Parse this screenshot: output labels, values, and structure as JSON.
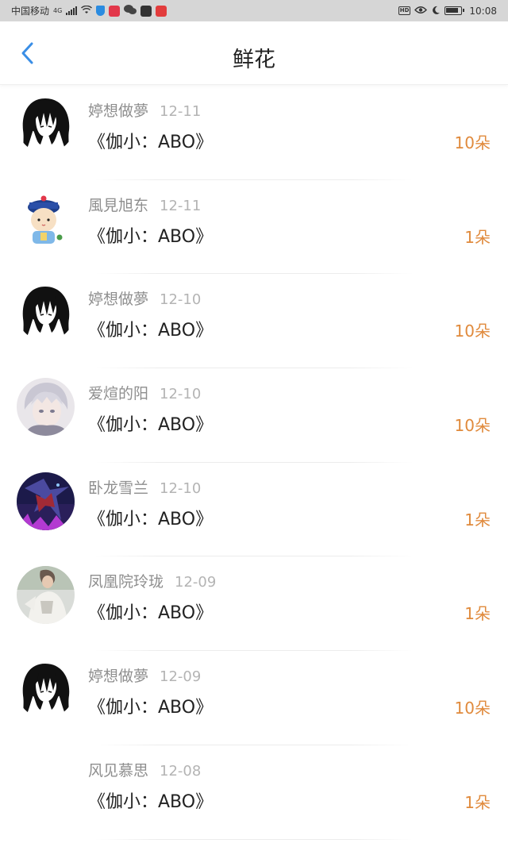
{
  "status_bar": {
    "carrier": "中国移动",
    "network": "4G",
    "time": "10:08",
    "hd_label": "HD"
  },
  "header": {
    "title": "鲜花",
    "back_icon": "chevron-left-icon"
  },
  "items": [
    {
      "name": "婷想做夢",
      "date": "12-11",
      "book": "《伽小：ABO》",
      "count": "10朵",
      "avatar": "black-hair-anime-avatar"
    },
    {
      "name": "風見旭东",
      "date": "12-11",
      "book": "《伽小：ABO》",
      "count": "1朵",
      "avatar": "chibi-qing-official-avatar"
    },
    {
      "name": "婷想做夢",
      "date": "12-10",
      "book": "《伽小：ABO》",
      "count": "10朵",
      "avatar": "black-hair-anime-avatar"
    },
    {
      "name": "爱煊的阳",
      "date": "12-10",
      "book": "《伽小：ABO》",
      "count": "10朵",
      "avatar": "silver-hair-anime-avatar"
    },
    {
      "name": "卧龙雪兰",
      "date": "12-10",
      "book": "《伽小：ABO》",
      "count": "1朵",
      "avatar": "dark-fantasy-avatar"
    },
    {
      "name": "凤凰院玲珑",
      "date": "12-09",
      "book": "《伽小：ABO》",
      "count": "1朵",
      "avatar": "photo-portrait-avatar"
    },
    {
      "name": "婷想做夢",
      "date": "12-09",
      "book": "《伽小：ABO》",
      "count": "10朵",
      "avatar": "black-hair-anime-avatar"
    },
    {
      "name": "风见慕思",
      "date": "12-08",
      "book": "《伽小：ABO》",
      "count": "1朵",
      "avatar": ""
    }
  ],
  "colors": {
    "accent": "#3a8ee6",
    "count": "#e08a3c",
    "name": "#8e8e8e",
    "date": "#b4b4b4"
  }
}
